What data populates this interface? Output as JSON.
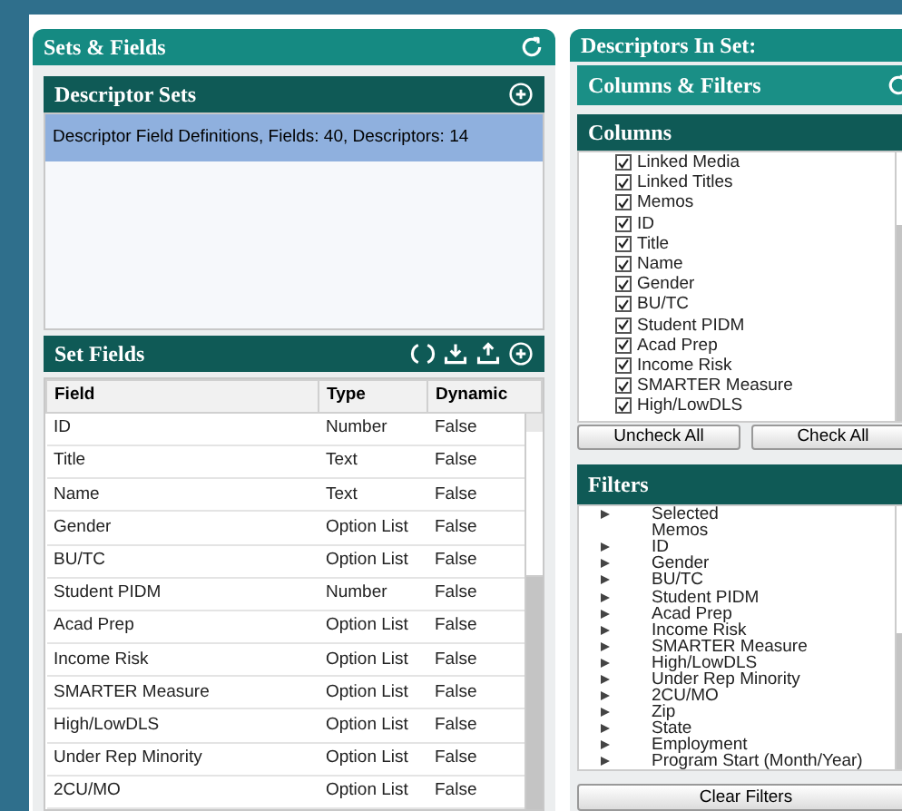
{
  "left_panel": {
    "title": "Sets & Fields",
    "descriptor_sets": {
      "title": "Descriptor Sets",
      "items": [
        {
          "label": "Descriptor Field Definitions, Fields: 40, Descriptors: 14",
          "selected": true
        }
      ]
    },
    "set_fields": {
      "title": "Set Fields",
      "columns": [
        "Field",
        "Type",
        "Dynamic"
      ],
      "rows": [
        [
          "ID",
          "Number",
          "False"
        ],
        [
          "Title",
          "Text",
          "False"
        ],
        [
          "Name",
          "Text",
          "False"
        ],
        [
          "Gender",
          "Option List",
          "False"
        ],
        [
          "BU/TC",
          "Option List",
          "False"
        ],
        [
          "Student PIDM",
          "Number",
          "False"
        ],
        [
          "Acad Prep",
          "Option List",
          "False"
        ],
        [
          "Income Risk",
          "Option List",
          "False"
        ],
        [
          "SMARTER Measure",
          "Option List",
          "False"
        ],
        [
          "High/LowDLS",
          "Option List",
          "False"
        ],
        [
          "Under Rep Minority",
          "Option List",
          "False"
        ],
        [
          "2CU/MO",
          "Option List",
          "False"
        ]
      ]
    }
  },
  "right_panel": {
    "title": "Descriptors In Set:",
    "subpanel_title": "Columns & Filters",
    "columns": {
      "title": "Columns",
      "items": [
        {
          "label": "Linked Media",
          "checked": true
        },
        {
          "label": "Linked Titles",
          "checked": true
        },
        {
          "label": "Memos",
          "checked": true
        },
        {
          "label": "ID",
          "checked": true
        },
        {
          "label": "Title",
          "checked": true
        },
        {
          "label": "Name",
          "checked": true
        },
        {
          "label": "Gender",
          "checked": true
        },
        {
          "label": "BU/TC",
          "checked": true
        },
        {
          "label": "Student PIDM",
          "checked": true
        },
        {
          "label": "Acad Prep",
          "checked": true
        },
        {
          "label": "Income Risk",
          "checked": true
        },
        {
          "label": "SMARTER Measure",
          "checked": true
        },
        {
          "label": "High/LowDLS",
          "checked": true
        }
      ],
      "buttons": [
        "Uncheck All",
        "Check All"
      ]
    },
    "filters": {
      "title": "Filters",
      "items": [
        {
          "label": "Selected",
          "expandable": true
        },
        {
          "label": "Memos",
          "expandable": false
        },
        {
          "label": "ID",
          "expandable": true
        },
        {
          "label": "Gender",
          "expandable": true
        },
        {
          "label": "BU/TC",
          "expandable": true
        },
        {
          "label": "Student PIDM",
          "expandable": true
        },
        {
          "label": "Acad Prep",
          "expandable": true
        },
        {
          "label": "Income Risk",
          "expandable": true
        },
        {
          "label": "SMARTER Measure",
          "expandable": true
        },
        {
          "label": "High/LowDLS",
          "expandable": true
        },
        {
          "label": "Under Rep Minority",
          "expandable": true
        },
        {
          "label": "2CU/MO",
          "expandable": true
        },
        {
          "label": "Zip",
          "expandable": true
        },
        {
          "label": "State",
          "expandable": true
        },
        {
          "label": "Employment",
          "expandable": true
        },
        {
          "label": "Program Start (Month/Year)",
          "expandable": true
        }
      ],
      "button": "Clear Filters"
    }
  }
}
